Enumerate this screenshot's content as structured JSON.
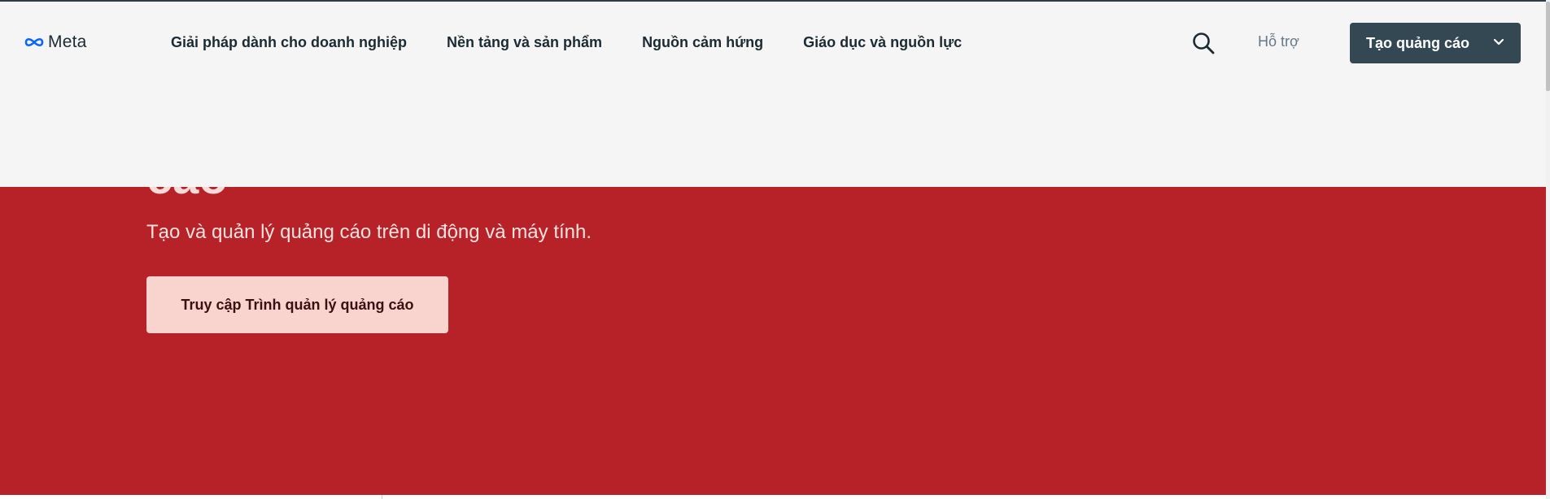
{
  "header": {
    "logo_text": "Meta",
    "nav": [
      {
        "label": "Giải pháp dành cho doanh nghiệp"
      },
      {
        "label": "Nền tảng và sản phẩm"
      },
      {
        "label": "Nguồn cảm hứng"
      },
      {
        "label": "Giáo dục và nguồn lực"
      }
    ],
    "search_icon": "search-icon",
    "support_label": "Hỗ trợ",
    "create_ad_label": "Tạo quảng cáo",
    "create_ad_icon": "chevron-down-icon"
  },
  "hero": {
    "heading_fragment": "cáo",
    "subtitle": "Tạo và quản lý quảng cáo trên di động và máy tính.",
    "cta_label": "Truy cập Trình quản lý quảng cáo"
  },
  "colors": {
    "header_bg": "#f5f5f5",
    "hero_bg": "#b72228",
    "primary_button_bg": "#344854",
    "cta_bg": "#f9d3ce",
    "logo_blue": "#0866ff"
  }
}
